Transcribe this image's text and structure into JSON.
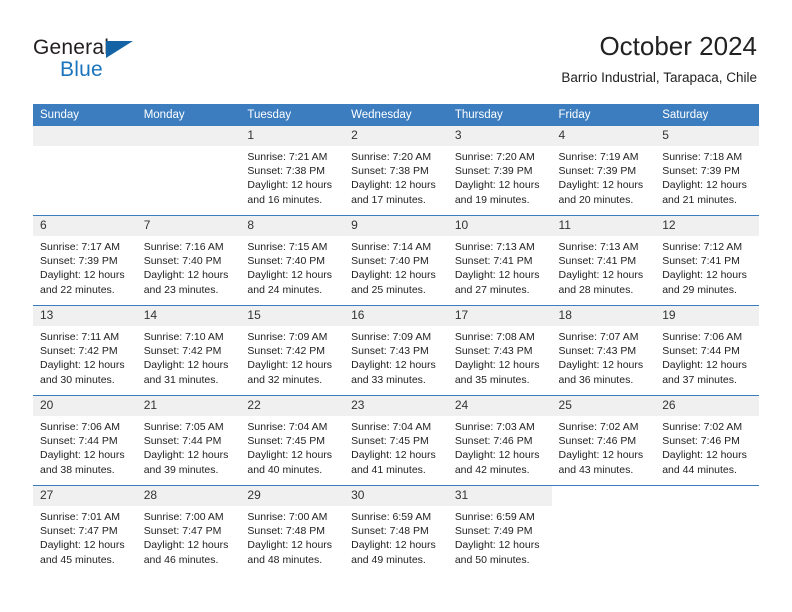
{
  "brand": {
    "line1": "General",
    "line2": "Blue",
    "triangle_color": "#1464a5",
    "blue_color": "#1c75bc"
  },
  "header": {
    "title": "October 2024",
    "subtitle": "Barrio Industrial, Tarapaca, Chile"
  },
  "theme": {
    "header_bg": "#3c7dbf",
    "daynum_bg": "#f0f0f0",
    "grid_line": "#3c7dbf",
    "text": "#222222"
  },
  "weekday_headers": [
    "Sunday",
    "Monday",
    "Tuesday",
    "Wednesday",
    "Thursday",
    "Friday",
    "Saturday"
  ],
  "weeks": [
    [
      {
        "day": "",
        "sunrise": "",
        "sunset": "",
        "daylight": "",
        "empty": true
      },
      {
        "day": "",
        "sunrise": "",
        "sunset": "",
        "daylight": "",
        "empty": true
      },
      {
        "day": "1",
        "sunrise": "Sunrise: 7:21 AM",
        "sunset": "Sunset: 7:38 PM",
        "daylight": "Daylight: 12 hours and 16 minutes."
      },
      {
        "day": "2",
        "sunrise": "Sunrise: 7:20 AM",
        "sunset": "Sunset: 7:38 PM",
        "daylight": "Daylight: 12 hours and 17 minutes."
      },
      {
        "day": "3",
        "sunrise": "Sunrise: 7:20 AM",
        "sunset": "Sunset: 7:39 PM",
        "daylight": "Daylight: 12 hours and 19 minutes."
      },
      {
        "day": "4",
        "sunrise": "Sunrise: 7:19 AM",
        "sunset": "Sunset: 7:39 PM",
        "daylight": "Daylight: 12 hours and 20 minutes."
      },
      {
        "day": "5",
        "sunrise": "Sunrise: 7:18 AM",
        "sunset": "Sunset: 7:39 PM",
        "daylight": "Daylight: 12 hours and 21 minutes."
      }
    ],
    [
      {
        "day": "6",
        "sunrise": "Sunrise: 7:17 AM",
        "sunset": "Sunset: 7:39 PM",
        "daylight": "Daylight: 12 hours and 22 minutes."
      },
      {
        "day": "7",
        "sunrise": "Sunrise: 7:16 AM",
        "sunset": "Sunset: 7:40 PM",
        "daylight": "Daylight: 12 hours and 23 minutes."
      },
      {
        "day": "8",
        "sunrise": "Sunrise: 7:15 AM",
        "sunset": "Sunset: 7:40 PM",
        "daylight": "Daylight: 12 hours and 24 minutes."
      },
      {
        "day": "9",
        "sunrise": "Sunrise: 7:14 AM",
        "sunset": "Sunset: 7:40 PM",
        "daylight": "Daylight: 12 hours and 25 minutes."
      },
      {
        "day": "10",
        "sunrise": "Sunrise: 7:13 AM",
        "sunset": "Sunset: 7:41 PM",
        "daylight": "Daylight: 12 hours and 27 minutes."
      },
      {
        "day": "11",
        "sunrise": "Sunrise: 7:13 AM",
        "sunset": "Sunset: 7:41 PM",
        "daylight": "Daylight: 12 hours and 28 minutes."
      },
      {
        "day": "12",
        "sunrise": "Sunrise: 7:12 AM",
        "sunset": "Sunset: 7:41 PM",
        "daylight": "Daylight: 12 hours and 29 minutes."
      }
    ],
    [
      {
        "day": "13",
        "sunrise": "Sunrise: 7:11 AM",
        "sunset": "Sunset: 7:42 PM",
        "daylight": "Daylight: 12 hours and 30 minutes."
      },
      {
        "day": "14",
        "sunrise": "Sunrise: 7:10 AM",
        "sunset": "Sunset: 7:42 PM",
        "daylight": "Daylight: 12 hours and 31 minutes."
      },
      {
        "day": "15",
        "sunrise": "Sunrise: 7:09 AM",
        "sunset": "Sunset: 7:42 PM",
        "daylight": "Daylight: 12 hours and 32 minutes."
      },
      {
        "day": "16",
        "sunrise": "Sunrise: 7:09 AM",
        "sunset": "Sunset: 7:43 PM",
        "daylight": "Daylight: 12 hours and 33 minutes."
      },
      {
        "day": "17",
        "sunrise": "Sunrise: 7:08 AM",
        "sunset": "Sunset: 7:43 PM",
        "daylight": "Daylight: 12 hours and 35 minutes."
      },
      {
        "day": "18",
        "sunrise": "Sunrise: 7:07 AM",
        "sunset": "Sunset: 7:43 PM",
        "daylight": "Daylight: 12 hours and 36 minutes."
      },
      {
        "day": "19",
        "sunrise": "Sunrise: 7:06 AM",
        "sunset": "Sunset: 7:44 PM",
        "daylight": "Daylight: 12 hours and 37 minutes."
      }
    ],
    [
      {
        "day": "20",
        "sunrise": "Sunrise: 7:06 AM",
        "sunset": "Sunset: 7:44 PM",
        "daylight": "Daylight: 12 hours and 38 minutes."
      },
      {
        "day": "21",
        "sunrise": "Sunrise: 7:05 AM",
        "sunset": "Sunset: 7:44 PM",
        "daylight": "Daylight: 12 hours and 39 minutes."
      },
      {
        "day": "22",
        "sunrise": "Sunrise: 7:04 AM",
        "sunset": "Sunset: 7:45 PM",
        "daylight": "Daylight: 12 hours and 40 minutes."
      },
      {
        "day": "23",
        "sunrise": "Sunrise: 7:04 AM",
        "sunset": "Sunset: 7:45 PM",
        "daylight": "Daylight: 12 hours and 41 minutes."
      },
      {
        "day": "24",
        "sunrise": "Sunrise: 7:03 AM",
        "sunset": "Sunset: 7:46 PM",
        "daylight": "Daylight: 12 hours and 42 minutes."
      },
      {
        "day": "25",
        "sunrise": "Sunrise: 7:02 AM",
        "sunset": "Sunset: 7:46 PM",
        "daylight": "Daylight: 12 hours and 43 minutes."
      },
      {
        "day": "26",
        "sunrise": "Sunrise: 7:02 AM",
        "sunset": "Sunset: 7:46 PM",
        "daylight": "Daylight: 12 hours and 44 minutes."
      }
    ],
    [
      {
        "day": "27",
        "sunrise": "Sunrise: 7:01 AM",
        "sunset": "Sunset: 7:47 PM",
        "daylight": "Daylight: 12 hours and 45 minutes."
      },
      {
        "day": "28",
        "sunrise": "Sunrise: 7:00 AM",
        "sunset": "Sunset: 7:47 PM",
        "daylight": "Daylight: 12 hours and 46 minutes."
      },
      {
        "day": "29",
        "sunrise": "Sunrise: 7:00 AM",
        "sunset": "Sunset: 7:48 PM",
        "daylight": "Daylight: 12 hours and 48 minutes."
      },
      {
        "day": "30",
        "sunrise": "Sunrise: 6:59 AM",
        "sunset": "Sunset: 7:48 PM",
        "daylight": "Daylight: 12 hours and 49 minutes."
      },
      {
        "day": "31",
        "sunrise": "Sunrise: 6:59 AM",
        "sunset": "Sunset: 7:49 PM",
        "daylight": "Daylight: 12 hours and 50 minutes."
      },
      {
        "day": "",
        "sunrise": "",
        "sunset": "",
        "daylight": "",
        "blank": true
      },
      {
        "day": "",
        "sunrise": "",
        "sunset": "",
        "daylight": "",
        "blank": true
      }
    ]
  ]
}
